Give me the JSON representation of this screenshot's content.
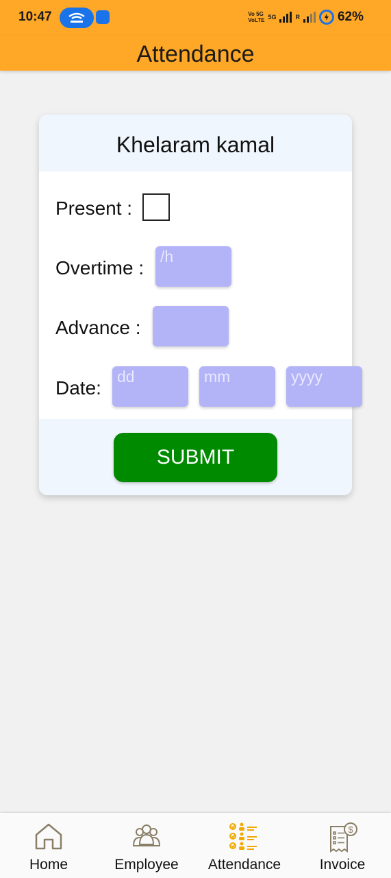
{
  "status_bar": {
    "time": "10:47",
    "network_labels": {
      "volte_top": "Vo 5G",
      "volte_bottom": "VoLTE",
      "fiveg": "5G",
      "roaming": "R"
    },
    "battery": "62%"
  },
  "header": {
    "title": "Attendance"
  },
  "card": {
    "employee_name": "Khelaram kamal",
    "present_label": "Present :",
    "present_checked": false,
    "overtime_label": "Overtime :",
    "overtime_placeholder": "/h",
    "advance_label": "Advance :",
    "advance_placeholder": "",
    "date_label": "Date:",
    "date_day_placeholder": "dd",
    "date_month_placeholder": "mm",
    "date_year_placeholder": "yyyy",
    "submit_label": "SUBMIT"
  },
  "bottom_nav": {
    "items": [
      {
        "label": "Home",
        "icon": "home-icon"
      },
      {
        "label": "Employee",
        "icon": "employee-icon"
      },
      {
        "label": "Attendance",
        "icon": "attendance-icon",
        "active": true
      },
      {
        "label": "Invoice",
        "icon": "invoice-icon"
      }
    ]
  },
  "colors": {
    "header": "#ffa726",
    "field": "#b3b3f8",
    "submit": "#008a00",
    "card": "#f0f6fd"
  }
}
